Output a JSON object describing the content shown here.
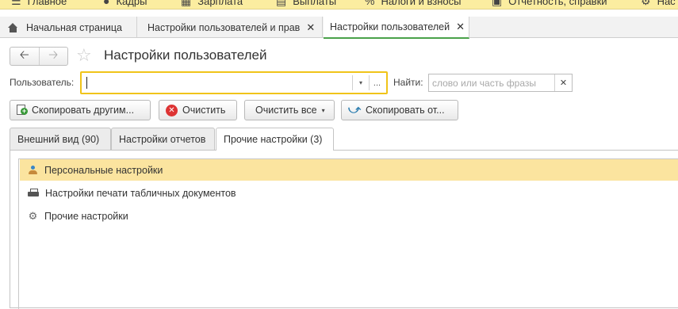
{
  "topmenu": {
    "items": [
      {
        "icon": "hamburger-icon",
        "glyph": "☰",
        "label": "Главное"
      },
      {
        "icon": "people-icon",
        "glyph": "👥",
        "label": "Кадры"
      },
      {
        "icon": "calculator-icon",
        "glyph": "▦",
        "label": "Зарплата"
      },
      {
        "icon": "wallet-icon",
        "glyph": "▤",
        "label": "Выплаты"
      },
      {
        "icon": "percent-icon",
        "glyph": "%",
        "label": "Налоги и взносы"
      },
      {
        "icon": "report-icon",
        "glyph": "▣",
        "label": "Отчетность, справки"
      },
      {
        "icon": "settings-icon",
        "glyph": "⚙",
        "label": "Нас"
      }
    ]
  },
  "tabs": [
    {
      "label": "Начальная страница",
      "icon": "home-icon"
    },
    {
      "label": "Настройки пользователей и прав",
      "close": "✕"
    },
    {
      "label": "Настройки пользователей",
      "close": "✕",
      "active": true
    }
  ],
  "form": {
    "title": "Настройки пользователей",
    "user_label": "Пользователь:",
    "user_value": "",
    "find_label": "Найти:",
    "search_placeholder": "слово или часть фразы",
    "dropdown_glyph": "▾",
    "dots_glyph": "...",
    "clear_glyph": "✕"
  },
  "commands": {
    "copy_to_others": "Скопировать другим...",
    "clear": "Очистить",
    "clear_all": "Очистить все",
    "copy_from": "Скопировать от..."
  },
  "sections": [
    {
      "label": "Внешний вид (90)"
    },
    {
      "label": "Настройки отчетов"
    },
    {
      "label": "Прочие настройки (3)",
      "active": true
    }
  ],
  "items": [
    {
      "label": "Персональные настройки",
      "icon": "person-icon",
      "selected": true
    },
    {
      "label": "Настройки печати табличных документов",
      "icon": "printer-icon"
    },
    {
      "label": "Прочие настройки",
      "icon": "gear-icon"
    }
  ],
  "colors": {
    "menu_bg": "#fbeda0",
    "active_tab_underline": "#4aa24a",
    "focus_border": "#f0c419",
    "selected_row": "#fbe49f",
    "clear_icon": "#dd3333"
  }
}
